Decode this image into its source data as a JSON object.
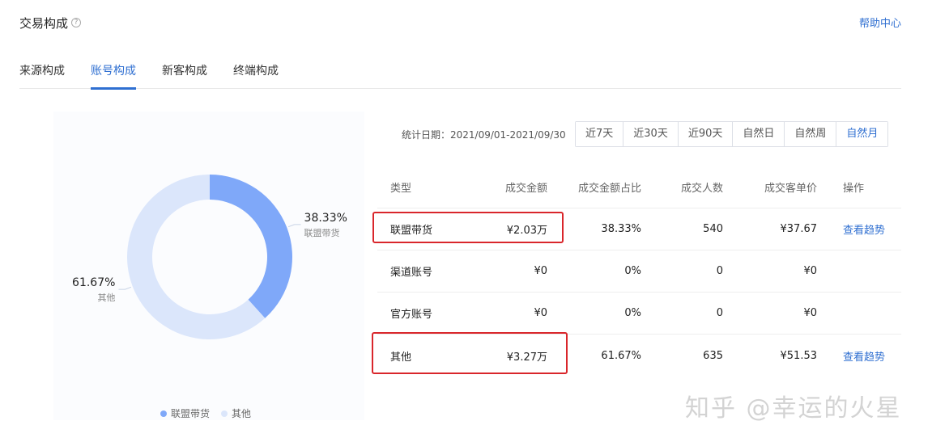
{
  "header": {
    "title": "交易构成",
    "help_mark": "?",
    "help_center": "帮助中心"
  },
  "tabs": [
    {
      "label": "来源构成",
      "active": false
    },
    {
      "label": "账号构成",
      "active": true
    },
    {
      "label": "新客构成",
      "active": false
    },
    {
      "label": "终端构成",
      "active": false
    }
  ],
  "date": {
    "label": "统计日期：2021/09/01-2021/09/30"
  },
  "ranges": [
    {
      "label": "近7天",
      "active": false
    },
    {
      "label": "近30天",
      "active": false
    },
    {
      "label": "近90天",
      "active": false
    },
    {
      "label": "自然日",
      "active": false
    },
    {
      "label": "自然周",
      "active": false
    },
    {
      "label": "自然月",
      "active": true
    }
  ],
  "table": {
    "headers": [
      "类型",
      "成交金额",
      "成交金额占比",
      "成交人数",
      "成交客单价",
      "操作"
    ],
    "rows": [
      {
        "type": "联盟带货",
        "amount": "¥2.03万",
        "ratio": "38.33%",
        "buyers": "540",
        "aov": "¥37.67",
        "action": "查看趋势"
      },
      {
        "type": "渠道账号",
        "amount": "¥0",
        "ratio": "0%",
        "buyers": "0",
        "aov": "¥0",
        "action": ""
      },
      {
        "type": "官方账号",
        "amount": "¥0",
        "ratio": "0%",
        "buyers": "0",
        "aov": "¥0",
        "action": ""
      },
      {
        "type": "其他",
        "amount": "¥3.27万",
        "ratio": "61.67%",
        "buyers": "635",
        "aov": "¥51.53",
        "action": "查看趋势"
      }
    ]
  },
  "chart_data": {
    "type": "pie",
    "donut": true,
    "slices": [
      {
        "name": "联盟带货",
        "value": 38.33,
        "label": "38.33%",
        "color": "#7fa8f9"
      },
      {
        "name": "其他",
        "value": 61.67,
        "label": "61.67%",
        "color": "#dbe6fb"
      }
    ],
    "legend": [
      "联盟带货",
      "其他"
    ],
    "legend_position": "bottom"
  },
  "watermark": "知乎 @幸运的火星"
}
